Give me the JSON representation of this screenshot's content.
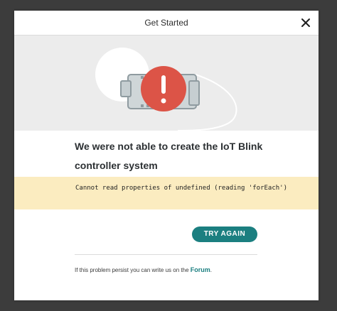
{
  "dialog": {
    "title": "Get Started",
    "close_icon": "close-icon",
    "illustration": "iot-board-error-icon"
  },
  "message": {
    "headline": "We were not able to create the IoT Blink controller system",
    "error_text": "Cannot read properties of undefined (reading 'forEach')"
  },
  "actions": {
    "try_again_label": "TRY AGAIN"
  },
  "footer": {
    "note": "If this problem persist you can write us on the",
    "link_label": "Forum",
    "trailing": "."
  },
  "colors": {
    "accent": "#1b7f80",
    "error_red": "#dc5447",
    "warning_bg": "#fbecc0"
  }
}
